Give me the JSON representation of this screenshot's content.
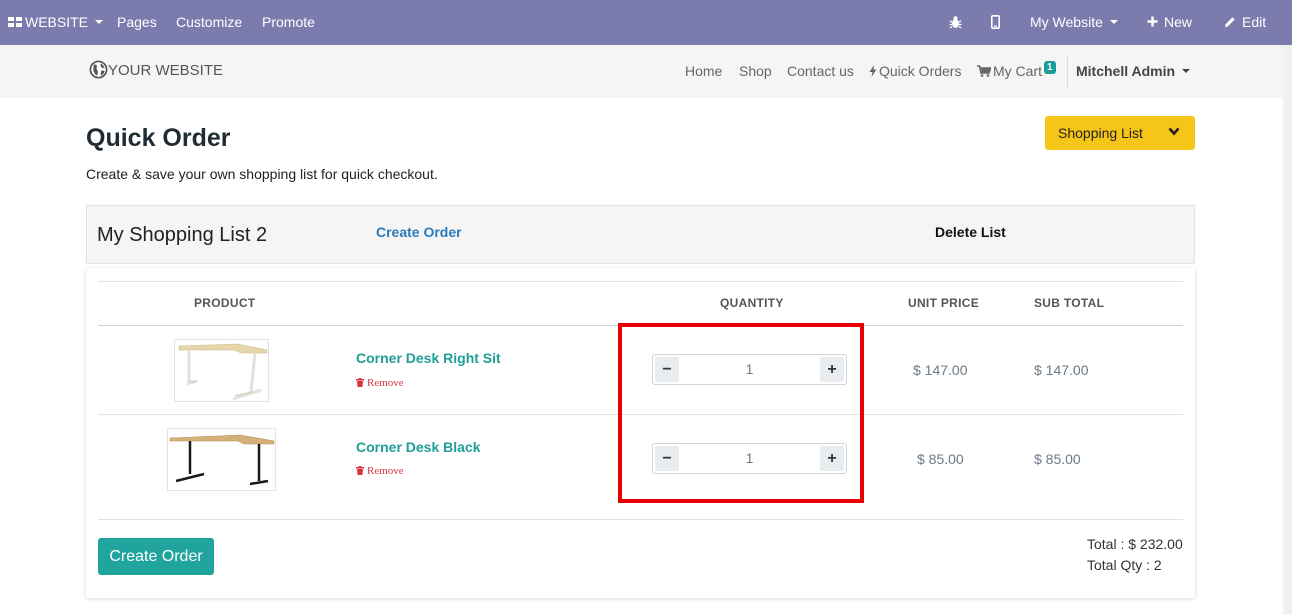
{
  "admin_bar": {
    "website_menu": "WEBSITE",
    "pages": "Pages",
    "customize": "Customize",
    "promote": "Promote",
    "my_website": "My Website",
    "new": "New",
    "edit": "Edit"
  },
  "header": {
    "logo_text": "YOUR WEBSITE",
    "nav": {
      "home": "Home",
      "shop": "Shop",
      "contact": "Contact us",
      "quick_orders": "Quick Orders",
      "my_cart": "My Cart",
      "cart_count": "1",
      "user": "Mitchell Admin"
    }
  },
  "page": {
    "title": "Quick Order",
    "subtitle": "Create & save your own shopping list for quick checkout.",
    "shopping_list_button": "Shopping List"
  },
  "list": {
    "name": "My Shopping List 2",
    "create_order_link": "Create Order",
    "delete_list": "Delete List"
  },
  "table": {
    "columns": {
      "product": "PRODUCT",
      "quantity": "QUANTITY",
      "unit_price": "UNIT PRICE",
      "sub_total": "SUB TOTAL"
    },
    "rows": [
      {
        "name": "Corner Desk Right Sit",
        "remove": "Remove",
        "qty_minus": "−",
        "qty_plus": "+",
        "quantity": "1",
        "unit_price": "$ 147.00",
        "sub_total": "$ 147.00"
      },
      {
        "name": "Corner Desk Black",
        "remove": "Remove",
        "qty_minus": "−",
        "qty_plus": "+",
        "quantity": "1",
        "unit_price": "$ 85.00",
        "sub_total": "$ 85.00"
      }
    ]
  },
  "footer": {
    "create_order_button": "Create Order",
    "total": "Total : $ 232.00",
    "total_qty": "Total Qty : 2"
  },
  "colors": {
    "admin_bar": "#7c7bad",
    "accent_teal": "#21a39e",
    "shopping_list_yellow": "#f5c518",
    "highlight_red": "#e60000"
  }
}
